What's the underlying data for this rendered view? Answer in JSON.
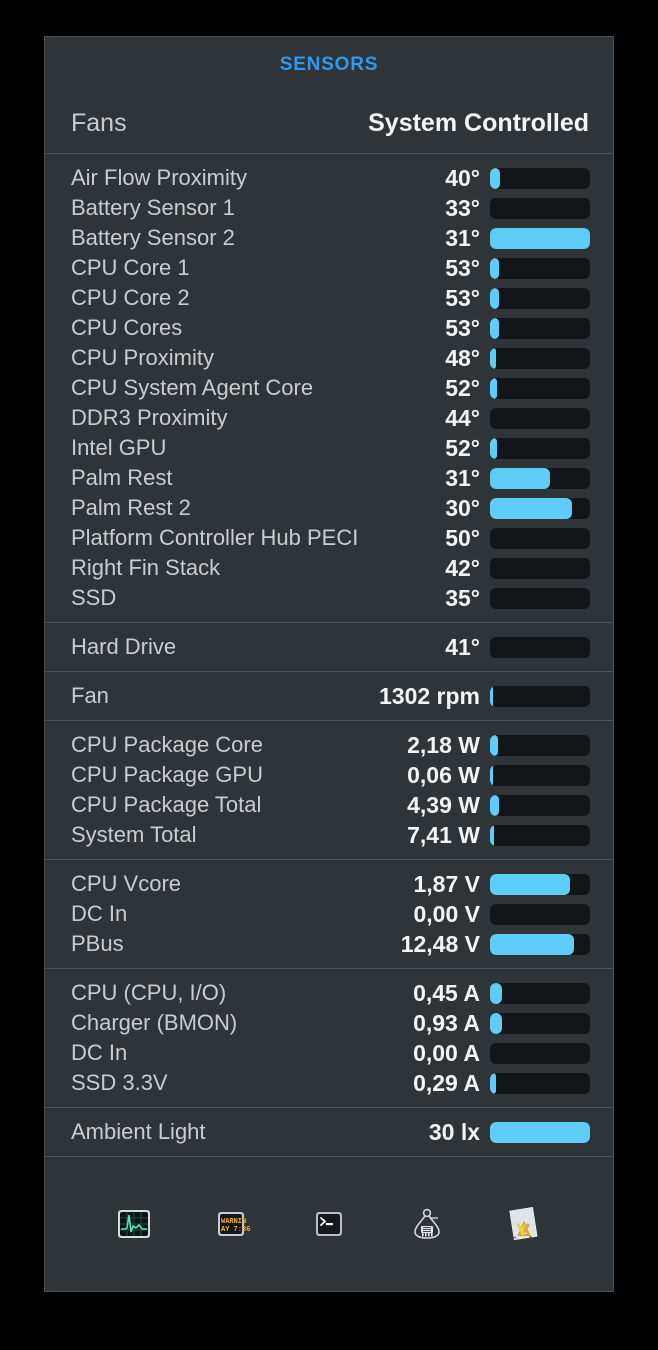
{
  "window": {
    "title": "SENSORS",
    "title_color": "#2e9bf0",
    "background": "#2f3438",
    "gauge_track_color": "#131619",
    "gauge_fill_color": "#5ecdf7"
  },
  "fan_control": {
    "label": "Fans",
    "value": "System Controlled"
  },
  "groups": [
    {
      "name": "temperatures",
      "rows": [
        {
          "label": "Air Flow Proximity",
          "value": "40°",
          "fill_pct": 10
        },
        {
          "label": "Battery Sensor 1",
          "value": "33°",
          "fill_pct": 0
        },
        {
          "label": "Battery Sensor 2",
          "value": "31°",
          "fill_pct": 100
        },
        {
          "label": "CPU Core 1",
          "value": "53°",
          "fill_pct": 9
        },
        {
          "label": "CPU Core 2",
          "value": "53°",
          "fill_pct": 9
        },
        {
          "label": "CPU Cores",
          "value": "53°",
          "fill_pct": 9
        },
        {
          "label": "CPU Proximity",
          "value": "48°",
          "fill_pct": 6
        },
        {
          "label": "CPU System Agent Core",
          "value": "52°",
          "fill_pct": 7
        },
        {
          "label": "DDR3 Proximity",
          "value": "44°",
          "fill_pct": 0
        },
        {
          "label": "Intel GPU",
          "value": "52°",
          "fill_pct": 7
        },
        {
          "label": "Palm Rest",
          "value": "31°",
          "fill_pct": 60
        },
        {
          "label": "Palm Rest 2",
          "value": "30°",
          "fill_pct": 82
        },
        {
          "label": "Platform Controller Hub PECI",
          "value": "50°",
          "fill_pct": 0
        },
        {
          "label": "Right Fin Stack",
          "value": "42°",
          "fill_pct": 0
        },
        {
          "label": "SSD",
          "value": "35°",
          "fill_pct": 0
        }
      ]
    },
    {
      "name": "drive-temperature",
      "rows": [
        {
          "label": "Hard Drive",
          "value": "41°",
          "fill_pct": 0
        }
      ]
    },
    {
      "name": "fan-speed",
      "rows": [
        {
          "label": "Fan",
          "value": "1302 rpm",
          "fill_pct": 3
        }
      ]
    },
    {
      "name": "power",
      "rows": [
        {
          "label": "CPU Package Core",
          "value": "2,18 W",
          "fill_pct": 8
        },
        {
          "label": "CPU Package GPU",
          "value": "0,06 W",
          "fill_pct": 3
        },
        {
          "label": "CPU Package Total",
          "value": "4,39 W",
          "fill_pct": 9
        },
        {
          "label": "System Total",
          "value": "7,41 W",
          "fill_pct": 4
        }
      ]
    },
    {
      "name": "voltage",
      "rows": [
        {
          "label": "CPU Vcore",
          "value": "1,87 V",
          "fill_pct": 80
        },
        {
          "label": "DC In",
          "value": "0,00 V",
          "fill_pct": 0
        },
        {
          "label": "PBus",
          "value": "12,48 V",
          "fill_pct": 84
        }
      ]
    },
    {
      "name": "current",
      "rows": [
        {
          "label": "CPU (CPU, I/O)",
          "value": "0,45 A",
          "fill_pct": 12
        },
        {
          "label": "Charger (BMON)",
          "value": "0,93 A",
          "fill_pct": 12
        },
        {
          "label": "DC In",
          "value": "0,00 A",
          "fill_pct": 0
        },
        {
          "label": "SSD 3.3V",
          "value": "0,29 A",
          "fill_pct": 6
        }
      ]
    },
    {
      "name": "ambient-light",
      "rows": [
        {
          "label": "Ambient Light",
          "value": "30 lx",
          "fill_pct": 100
        }
      ]
    }
  ],
  "footer": {
    "buttons": [
      {
        "icon": "activity-monitor-icon"
      },
      {
        "icon": "console-log-icon"
      },
      {
        "icon": "terminal-icon"
      },
      {
        "icon": "system-information-icon"
      },
      {
        "icon": "utilities-folder-icon"
      }
    ]
  }
}
